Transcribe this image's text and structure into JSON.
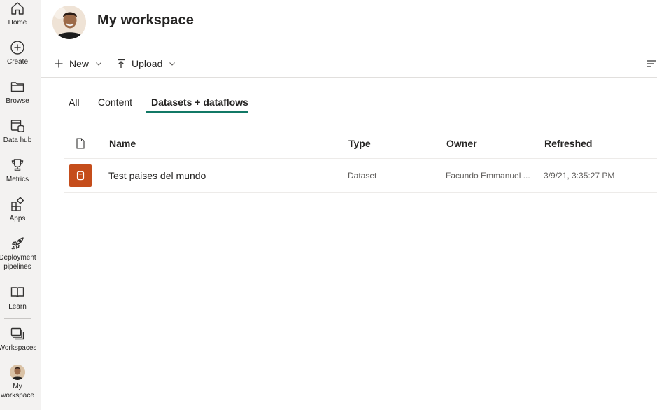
{
  "nav": {
    "items": [
      {
        "label": "Home",
        "icon": "home-icon"
      },
      {
        "label": "Create",
        "icon": "create-icon"
      },
      {
        "label": "Browse",
        "icon": "folder-icon"
      },
      {
        "label": "Data hub",
        "icon": "data-hub-icon"
      },
      {
        "label": "Metrics",
        "icon": "trophy-icon"
      },
      {
        "label": "Apps",
        "icon": "apps-icon"
      },
      {
        "label": "Deployment\npipelines",
        "icon": "rocket-icon"
      },
      {
        "label": "Learn",
        "icon": "book-icon"
      },
      {
        "label": "Workspaces",
        "icon": "workspaces-icon"
      },
      {
        "label": "My\nworkspace",
        "icon": "avatar"
      }
    ]
  },
  "header": {
    "title": "My workspace"
  },
  "toolbar": {
    "new_label": "New",
    "upload_label": "Upload"
  },
  "tabs": [
    {
      "label": "All",
      "active": false
    },
    {
      "label": "Content",
      "active": false
    },
    {
      "label": "Datasets + dataflows",
      "active": true
    }
  ],
  "table": {
    "columns": [
      "Name",
      "Type",
      "Owner",
      "Refreshed"
    ],
    "rows": [
      {
        "name": "Test paises del mundo",
        "type": "Dataset",
        "owner": "Facundo Emmanuel ...",
        "refreshed": "3/9/21, 3:35:27 PM"
      }
    ]
  },
  "colors": {
    "accent": "#117865",
    "dataset_icon": "#c54d1b",
    "rail_bg": "#f3f2f1"
  }
}
